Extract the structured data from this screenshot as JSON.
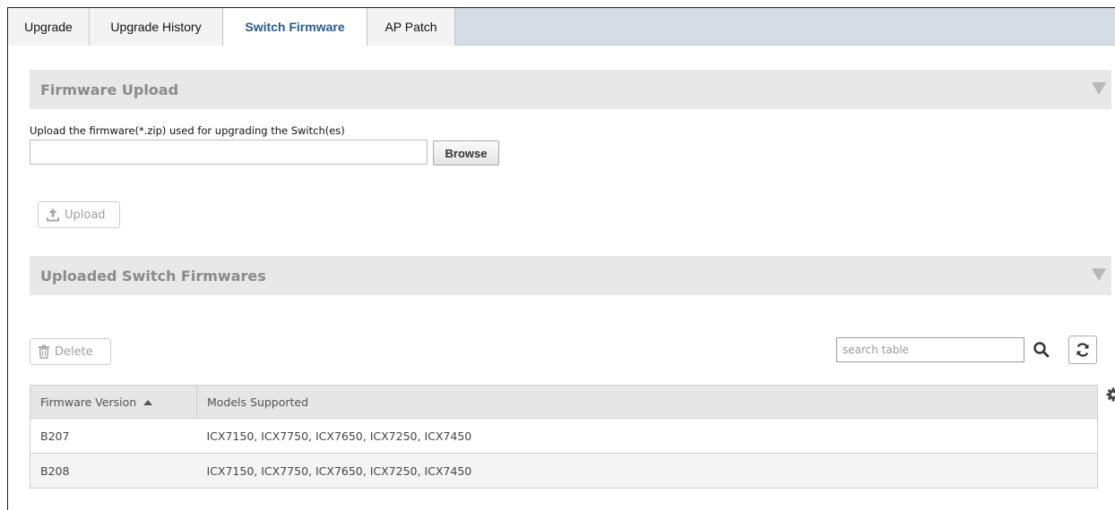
{
  "tabs": [
    {
      "label": "Upgrade",
      "active": false
    },
    {
      "label": "Upgrade History",
      "active": false
    },
    {
      "label": "Switch Firmware",
      "active": true
    },
    {
      "label": "AP Patch",
      "active": false
    }
  ],
  "firmware_upload": {
    "title": "Firmware Upload",
    "instruction": "Upload the firmware(*.zip) used for upgrading the Switch(es)",
    "file_value": "",
    "browse_label": "Browse",
    "upload_label": "Upload",
    "upload_icon": "upload-icon"
  },
  "uploaded": {
    "title": "Uploaded Switch Firmwares",
    "delete_label": "Delete",
    "delete_icon": "trash-icon",
    "search_placeholder": "search table",
    "search_icon": "search-icon",
    "refresh_icon": "refresh-icon",
    "settings_icon": "gear-icon"
  },
  "table": {
    "columns": [
      "Firmware Version",
      "Models Supported"
    ],
    "sorted_column": "Firmware Version",
    "sort_direction": "ascending",
    "rows": [
      {
        "version": "B207",
        "models": "ICX7150, ICX7750, ICX7650, ICX7250, ICX7450"
      },
      {
        "version": "B208",
        "models": "ICX7150, ICX7750, ICX7650, ICX7250, ICX7450"
      }
    ]
  },
  "colors": {
    "active_tab_text": "#2a5a8c",
    "tab_bar": "#d6dce4",
    "section_header": "#e8e8e8"
  }
}
